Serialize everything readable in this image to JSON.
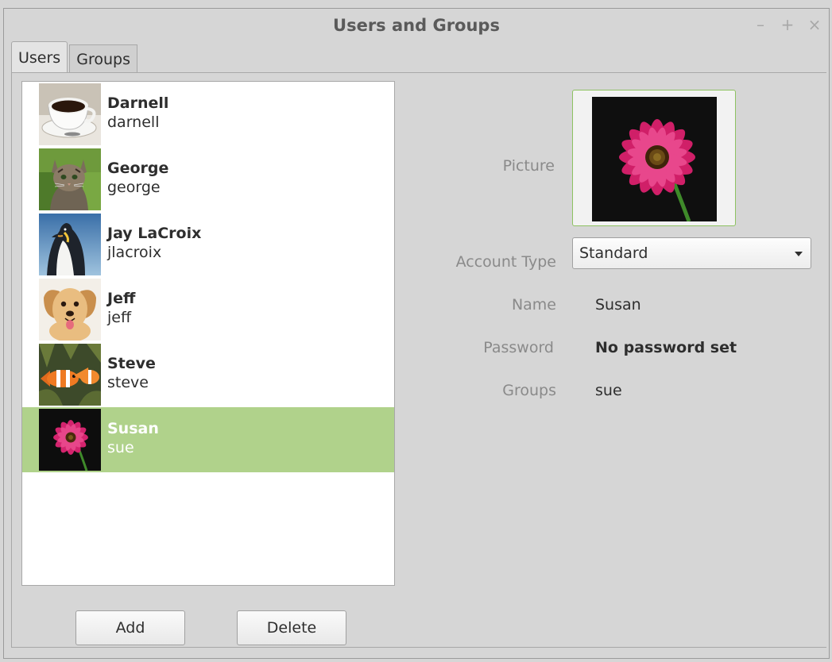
{
  "window": {
    "title": "Users and Groups",
    "controls": {
      "minimize": "–",
      "maximize": "+",
      "close": "×"
    }
  },
  "tabs": [
    {
      "label": "Users",
      "active": true
    },
    {
      "label": "Groups",
      "active": false
    }
  ],
  "users": [
    {
      "full_name": "Darnell",
      "login": "darnell",
      "avatar": "coffee-cup-icon"
    },
    {
      "full_name": "George",
      "login": "george",
      "avatar": "kitten-icon"
    },
    {
      "full_name": "Jay LaCroix",
      "login": "jlacroix",
      "avatar": "penguin-icon"
    },
    {
      "full_name": "Jeff",
      "login": "jeff",
      "avatar": "puppy-icon"
    },
    {
      "full_name": "Steve",
      "login": "steve",
      "avatar": "clownfish-icon"
    },
    {
      "full_name": "Susan",
      "login": "sue",
      "avatar": "pink-flower-icon",
      "selected": true
    }
  ],
  "buttons": {
    "add": "Add",
    "delete": "Delete"
  },
  "details": {
    "picture_label": "Picture",
    "picture_icon": "pink-flower-icon",
    "account_type_label": "Account Type",
    "account_type_value": "Standard",
    "name_label": "Name",
    "name_value": "Susan",
    "password_label": "Password",
    "password_value": "No password set",
    "groups_label": "Groups",
    "groups_value": "sue"
  },
  "colors": {
    "selection": "#b0d28b",
    "picture_border": "#8ec262",
    "background": "#d6d6d6"
  }
}
